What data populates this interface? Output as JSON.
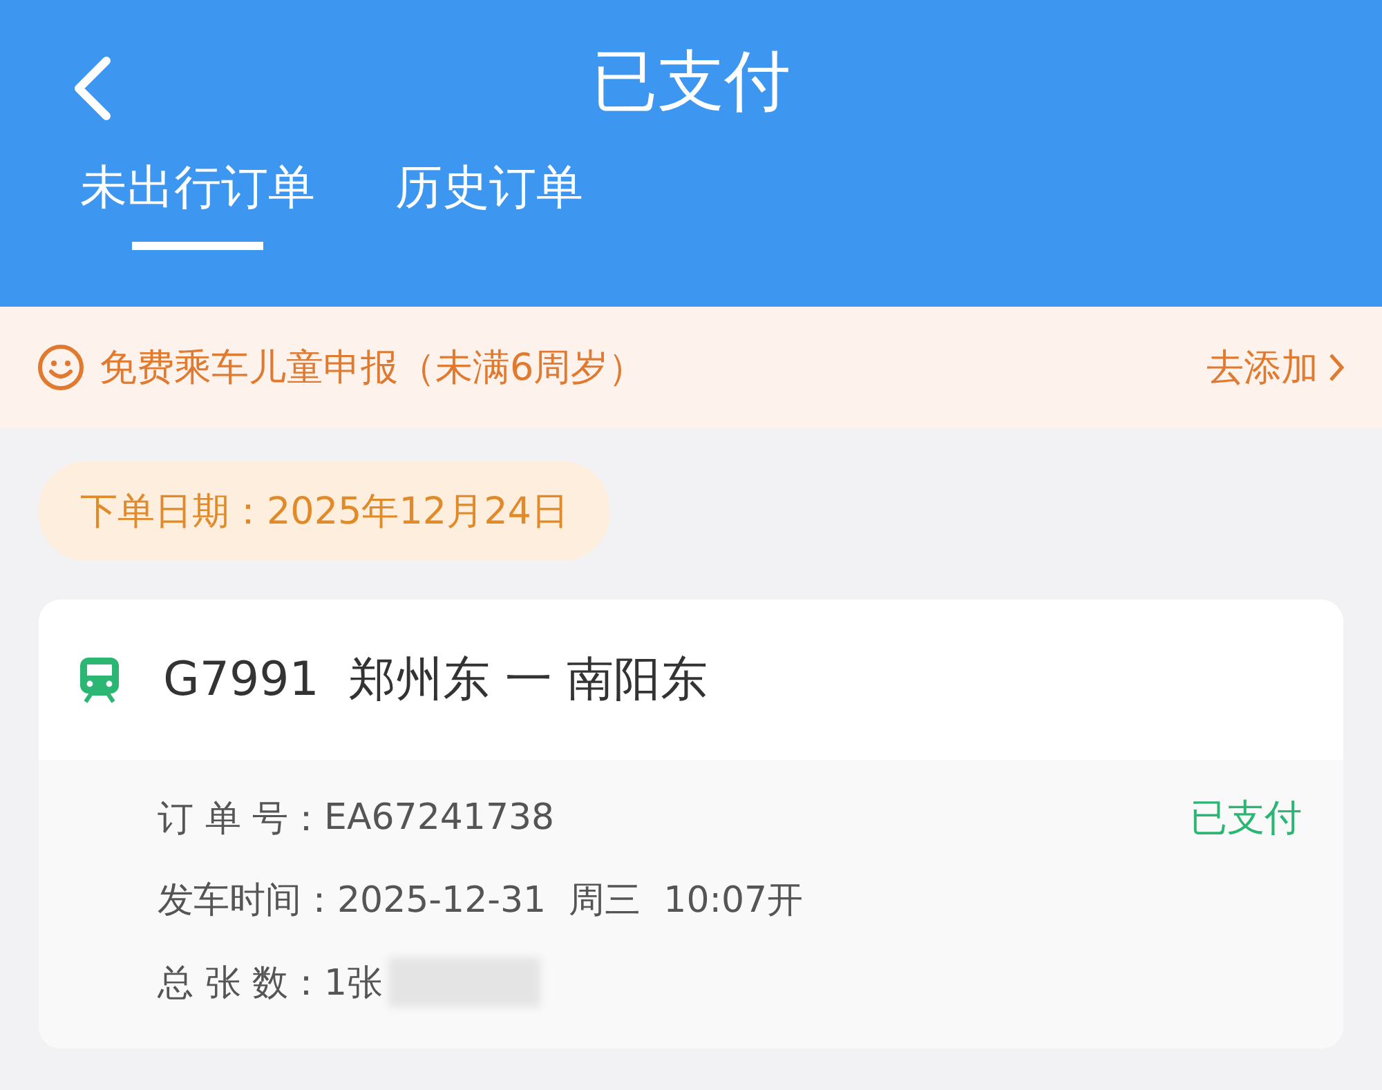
{
  "header": {
    "title": "已支付"
  },
  "tabs": [
    {
      "label": "未出行订单",
      "selected": true
    },
    {
      "label": "历史订单",
      "selected": false
    }
  ],
  "banner": {
    "text": "免费乘车儿童申报（未满6周岁）",
    "action": "去添加"
  },
  "order_date": "下单日期：2025年12月24日",
  "order": {
    "train": "G7991",
    "route": "郑州东 一 南阳东",
    "status": "已支付",
    "details": [
      {
        "label": "订 单 号：",
        "value": "EA67241738",
        "redacted": false
      },
      {
        "label": "发车时间：",
        "value": "2025-12-31  周三  10:07开",
        "redacted": false
      },
      {
        "label": "总 张 数：",
        "value": "1张",
        "redacted": true
      }
    ]
  }
}
